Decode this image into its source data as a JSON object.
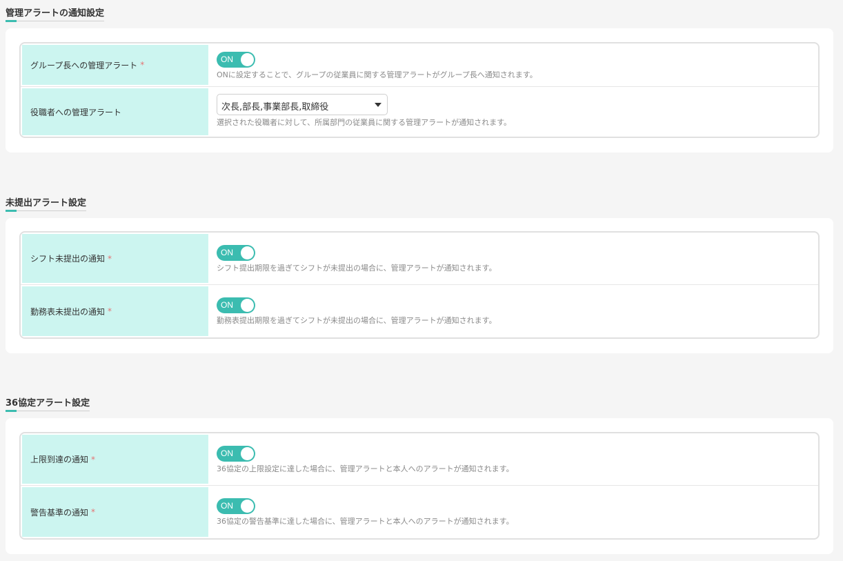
{
  "sections": [
    {
      "title": "管理アラートの通知設定",
      "rows": [
        {
          "label": "グループ長への管理アラート",
          "required": "*",
          "toggle": "ON",
          "help": "ONに設定することで、グループの従業員に関する管理アラートがグループ長へ通知されます。"
        },
        {
          "label": "役職者への管理アラート",
          "select_value": "次長,部長,事業部長,取締役",
          "help": "選択された役職者に対して、所属部門の従業員に関する管理アラートが通知されます。"
        }
      ]
    },
    {
      "title": "未提出アラート設定",
      "rows": [
        {
          "label": "シフト未提出の通知",
          "required": "*",
          "toggle": "ON",
          "help": "シフト提出期限を過ぎてシフトが未提出の場合に、管理アラートが通知されます。"
        },
        {
          "label": "勤務表未提出の通知",
          "required": "*",
          "toggle": "ON",
          "help": "勤務表提出期限を過ぎてシフトが未提出の場合に、管理アラートが通知されます。"
        }
      ]
    },
    {
      "title": "36協定アラート設定",
      "rows": [
        {
          "label": "上限到達の通知",
          "required": "*",
          "toggle": "ON",
          "help": "36協定の上限設定に達した場合に、管理アラートと本人へのアラートが通知されます。"
        },
        {
          "label": "警告基準の通知",
          "required": "*",
          "toggle": "ON",
          "help": "36協定の警告基準に達した場合に、管理アラートと本人へのアラートが通知されます。"
        }
      ]
    }
  ],
  "colors": {
    "accent": "#3bbcb0",
    "label_bg": "#ccf5f0",
    "required": "#e57373"
  }
}
